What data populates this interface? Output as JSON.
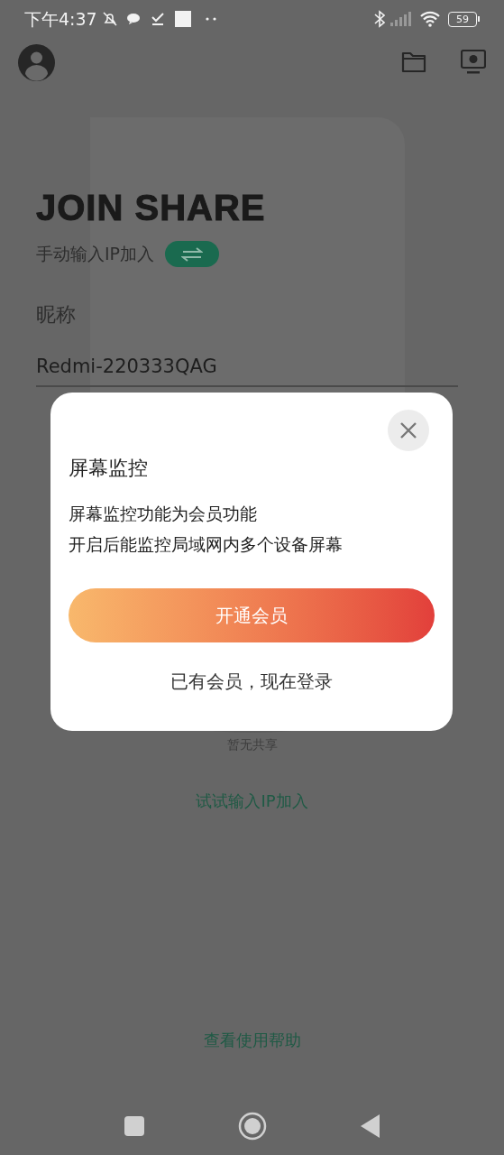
{
  "status_bar": {
    "time": "下午4:37",
    "battery": "59"
  },
  "header": {
    "title": "JOIN SHARE",
    "mode_label": "手动输入IP加入",
    "manual_ip": false
  },
  "nickname": {
    "label": "昵称",
    "value": "Redmi-220333QAG"
  },
  "empty_state": {
    "text": "暂无共享",
    "link": "试试输入IP加入"
  },
  "help_link": "查看使用帮助",
  "dialog": {
    "title": "屏幕监控",
    "lines": [
      "屏幕监控功能为会员功能",
      "开启后能监控局域网内多个设备屏幕"
    ],
    "primary_button": "开通会员",
    "secondary_link": "已有会员，现在登录"
  }
}
